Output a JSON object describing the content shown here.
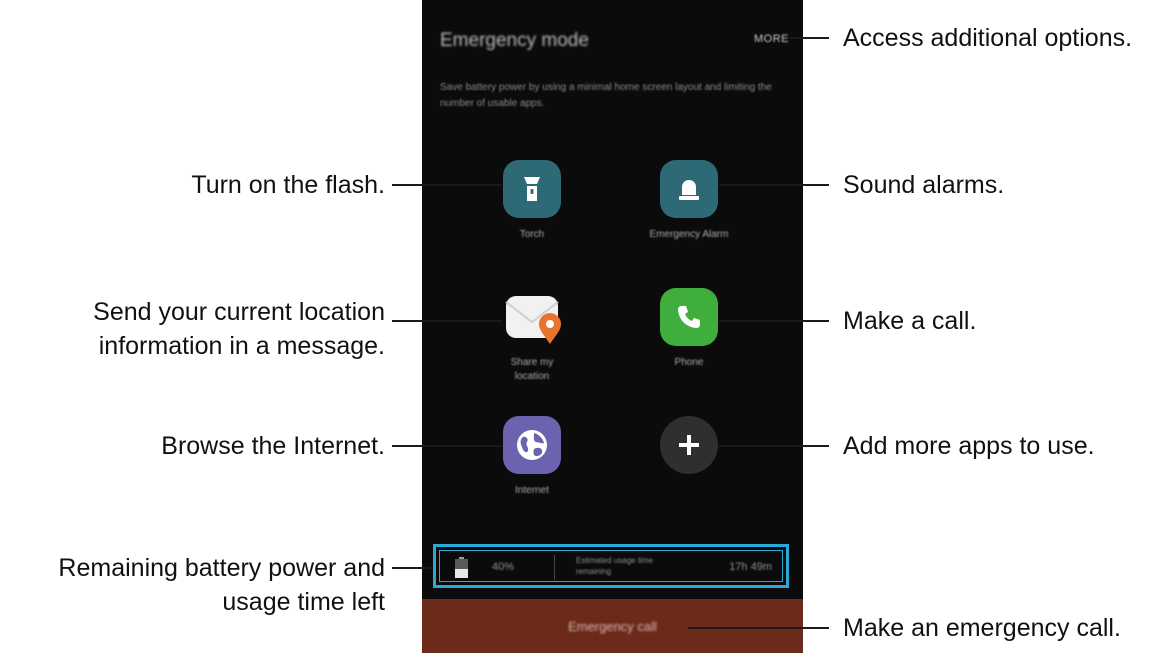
{
  "phone": {
    "title": "Emergency mode",
    "more": "MORE",
    "description": "Save battery power by using a minimal home screen layout and limiting the number of usable apps.",
    "apps": {
      "torch": "Torch",
      "alarm": "Emergency Alarm",
      "share": "Share my location",
      "phone": "Phone",
      "internet": "Internet"
    },
    "battery": {
      "percent": "40%",
      "label": "Estimated usage time remaining",
      "time": "17h 49m"
    },
    "emergency_call": "Emergency call"
  },
  "callouts": {
    "more": "Access additional options.",
    "flash": "Turn on the flash.",
    "alarm": "Sound alarms.",
    "location_line1": "Send your current location",
    "location_line2": "information in a message.",
    "call": "Make a call.",
    "internet": "Browse the Internet.",
    "add": "Add more apps to use.",
    "battery_line1": "Remaining battery power and",
    "battery_line2": "usage time left",
    "emergency": "Make an emergency call."
  },
  "colors": {
    "highlight": "#2aa8d8",
    "torch_icon": "#2e6a75",
    "phone_icon": "#3fae3c",
    "internet_icon": "#6b63b0",
    "emergency_bar": "#6b2a1a",
    "location_pin": "#e8742c"
  },
  "icons": {
    "torch": "flashlight-icon",
    "alarm": "siren-icon",
    "share": "envelope-location-icon",
    "phone": "phone-handset-icon",
    "internet": "globe-icon",
    "add": "plus-icon",
    "battery": "battery-icon"
  }
}
